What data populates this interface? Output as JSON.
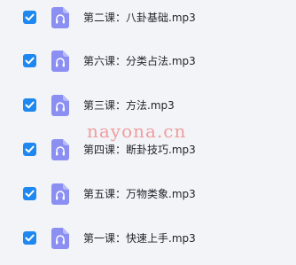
{
  "files": [
    {
      "name": "第二课：八卦基础.mp3",
      "checked": true,
      "icon": "audio-file-icon"
    },
    {
      "name": "第六课：分类占法.mp3",
      "checked": true,
      "icon": "audio-file-icon"
    },
    {
      "name": "第三课：方法.mp3",
      "checked": true,
      "icon": "audio-file-icon"
    },
    {
      "name": "第四课：断卦技巧.mp3",
      "checked": true,
      "icon": "audio-file-icon"
    },
    {
      "name": "第五课：万物类象.mp3",
      "checked": true,
      "icon": "audio-file-icon"
    },
    {
      "name": "第一课：快速上手.mp3",
      "checked": true,
      "icon": "audio-file-icon"
    }
  ],
  "watermark": "nayona.cn",
  "colors": {
    "background": "#f2f4f8",
    "checkbox": "#1e88f0",
    "file_icon": "#8b8ff2",
    "text": "#1f2329",
    "watermark": "#f08080"
  }
}
